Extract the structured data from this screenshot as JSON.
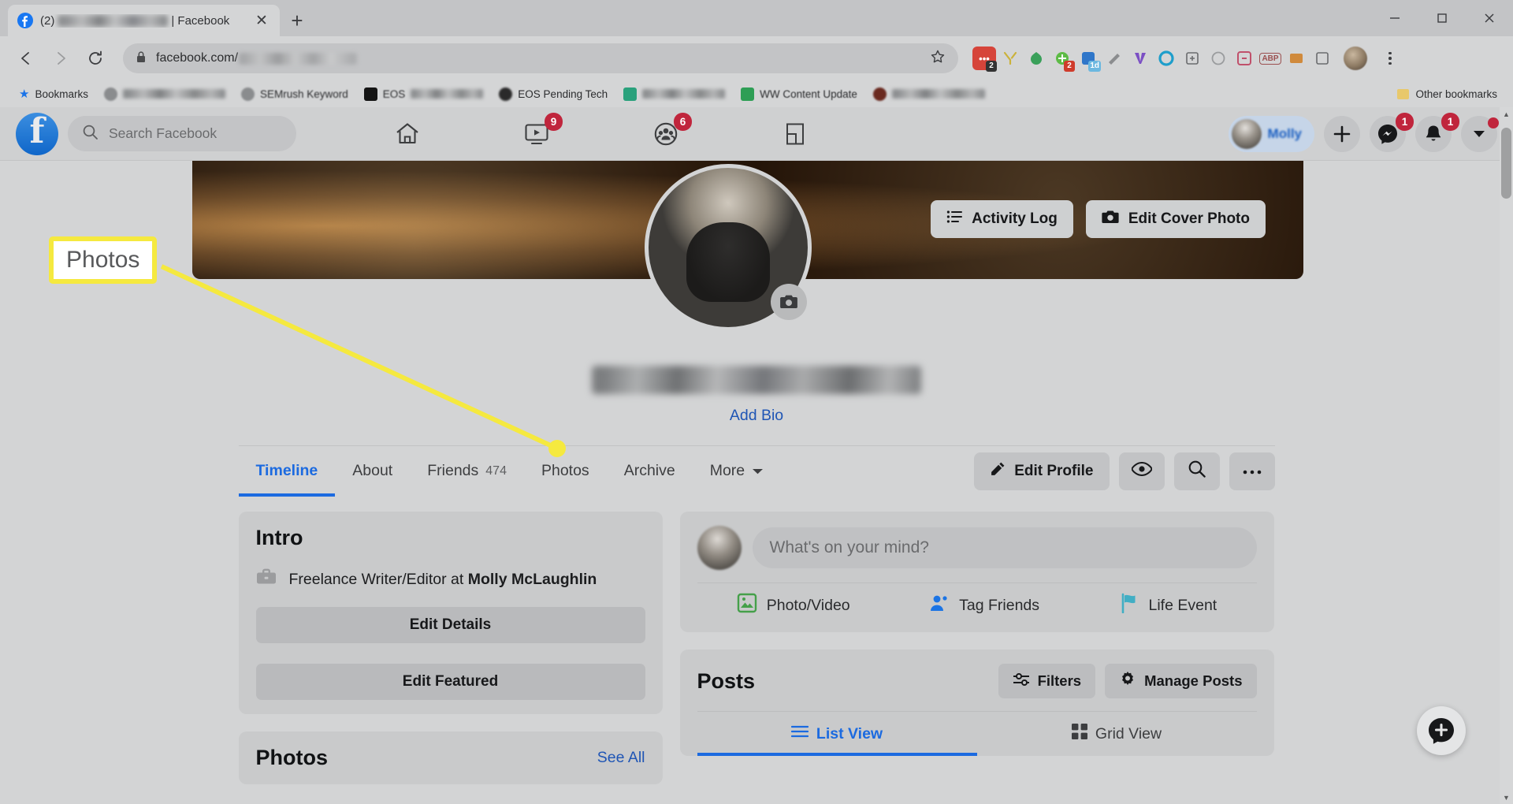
{
  "browser": {
    "tab": {
      "title": "(2) | Facebook",
      "prefix": "(2)",
      "suffix": "| Facebook",
      "close": "✕"
    },
    "newtab_label": "+",
    "url": {
      "scheme_icon": "lock-icon",
      "text": "facebook.com/"
    },
    "bookmarks_label": "Bookmarks",
    "other_bookmarks_label": "Other bookmarks",
    "bookmark_items": [
      {
        "label": "",
        "blur_width": 130,
        "icon": "globe-icon",
        "icon_color": "#8a8c8e"
      },
      {
        "label": "SEMrush Keyword",
        "blur_width": 0,
        "icon": "key-icon",
        "icon_color": "#8a8c8e"
      },
      {
        "label": "EOS",
        "blur_width": 92,
        "icon": "black-square-icon",
        "icon_color": "#141414"
      },
      {
        "label": "EOS Pending Tech",
        "blur_width": 0,
        "icon": "dark-icon",
        "icon_color": "#2a2a2a"
      },
      {
        "label": "",
        "blur_width": 105,
        "icon": "teal-icon",
        "icon_color": "#2aa17c"
      },
      {
        "label": "WW Content Update",
        "blur_width": 0,
        "icon": "green-icon",
        "icon_color": "#2e9e55"
      },
      {
        "label": "",
        "blur_width": 118,
        "icon": "red-icon",
        "icon_color": "#6a2a20"
      }
    ],
    "extensions": [
      {
        "name": "extension-red",
        "color": "#d6443a",
        "badge": "2",
        "badge_color": "#333333"
      },
      {
        "name": "extension-yellow",
        "color": "#cbb23a",
        "badge": "",
        "badge_color": ""
      },
      {
        "name": "extension-green",
        "color": "#3aa05a",
        "badge": "",
        "badge_color": ""
      },
      {
        "name": "extension-lime",
        "color": "#5dbb46",
        "badge": "2",
        "badge_color": "#cf3b2b"
      },
      {
        "name": "extension-blue",
        "color": "#2f76c9",
        "badge": "1d",
        "badge_color": "#6cb8e0"
      },
      {
        "name": "extension-grey",
        "color": "#8b8d8f",
        "badge": "",
        "badge_color": ""
      },
      {
        "name": "extension-purple",
        "color": "#7b4fc4",
        "badge": "",
        "badge_color": ""
      },
      {
        "name": "extension-teal",
        "color": "#1e9ecb",
        "badge": "",
        "badge_color": ""
      },
      {
        "name": "extension-dark",
        "color": "#6a6c6e",
        "badge": "",
        "badge_color": ""
      },
      {
        "name": "extension-circle",
        "color": "#9a9c9e",
        "badge": "",
        "badge_color": ""
      },
      {
        "name": "extension-pink",
        "color": "#c0506b",
        "badge": "",
        "badge_color": ""
      },
      {
        "name": "extension-abp",
        "color": "#9b5050",
        "badge": "",
        "badge_color": ""
      },
      {
        "name": "extension-orange",
        "color": "#d08a3c",
        "badge": "",
        "badge_color": ""
      }
    ]
  },
  "facebook": {
    "search_placeholder": "Search Facebook",
    "nav": [
      {
        "name": "home",
        "badge": ""
      },
      {
        "name": "watch",
        "badge": "9"
      },
      {
        "name": "groups",
        "badge": "6"
      },
      {
        "name": "gaming",
        "badge": ""
      }
    ],
    "profile_chip_name": "Molly",
    "right_actions": [
      {
        "name": "create",
        "badge": ""
      },
      {
        "name": "messenger",
        "badge": "1"
      },
      {
        "name": "notifications",
        "badge": "1"
      },
      {
        "name": "account-menu",
        "badge": "dot"
      }
    ],
    "cover": {
      "activity_log": "Activity Log",
      "edit_cover_photo": "Edit Cover Photo"
    },
    "add_bio": "Add Bio",
    "tabs": [
      {
        "label": "Timeline",
        "count": "",
        "active": true
      },
      {
        "label": "About",
        "count": "",
        "active": false
      },
      {
        "label": "Friends",
        "count": "474",
        "active": false
      },
      {
        "label": "Photos",
        "count": "",
        "active": false
      },
      {
        "label": "Archive",
        "count": "",
        "active": false
      },
      {
        "label": "More",
        "count": "",
        "active": false,
        "caret": true
      }
    ],
    "tab_actions": {
      "edit_profile": "Edit Profile",
      "view_as": "eye-icon",
      "search": "search-icon",
      "more": "ellipsis-icon"
    },
    "intro": {
      "title": "Intro",
      "work_prefix": "Freelance Writer/Editor at ",
      "work_employer": "Molly McLaughlin",
      "edit_details": "Edit Details",
      "edit_featured": "Edit Featured"
    },
    "composer": {
      "placeholder": "What's on your mind?",
      "actions": [
        {
          "label": "Photo/Video",
          "icon": "photo-icon",
          "color": "#45a04a"
        },
        {
          "label": "Tag Friends",
          "icon": "tag-friends-icon",
          "color": "#1b74e4"
        },
        {
          "label": "Life Event",
          "icon": "flag-icon",
          "color": "#41aec4"
        }
      ]
    },
    "posts": {
      "title": "Posts",
      "filters": "Filters",
      "manage_posts": "Manage Posts",
      "views": [
        {
          "label": "List View",
          "icon": "list-icon",
          "active": true
        },
        {
          "label": "Grid View",
          "icon": "grid-icon",
          "active": false
        }
      ]
    },
    "photos_card": {
      "title": "Photos",
      "see_all": "See All"
    }
  },
  "annotation": {
    "label": "Photos",
    "box_color": "#f5e93f",
    "line_color": "#f5e93f"
  }
}
